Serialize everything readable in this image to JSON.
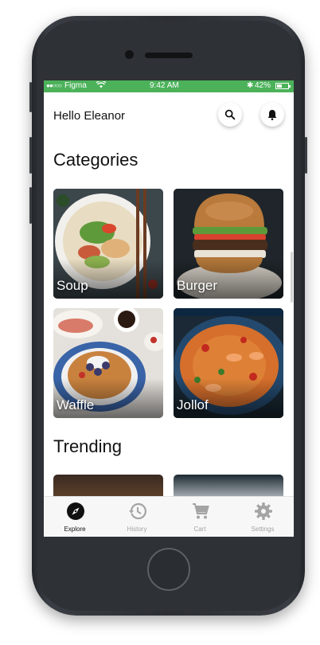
{
  "status_bar": {
    "carrier": "Figma",
    "time": "9:42 AM",
    "battery": "42%"
  },
  "header": {
    "greeting": "Hello Eleanor"
  },
  "sections": {
    "categories_title": "Categories",
    "trending_title": "Trending"
  },
  "categories": [
    {
      "label": "Soup"
    },
    {
      "label": "Burger"
    },
    {
      "label": "Waffle"
    },
    {
      "label": "Jollof"
    }
  ],
  "tabs": [
    {
      "label": "Explore",
      "icon": "compass-icon",
      "active": true
    },
    {
      "label": "History",
      "icon": "history-icon",
      "active": false
    },
    {
      "label": "Cart",
      "icon": "cart-icon",
      "active": false
    },
    {
      "label": "Settings",
      "icon": "gear-icon",
      "active": false
    }
  ],
  "colors": {
    "status_bar": "#4cb25a",
    "active_tab": "#111111",
    "inactive_tab": "#a4a4a4"
  }
}
